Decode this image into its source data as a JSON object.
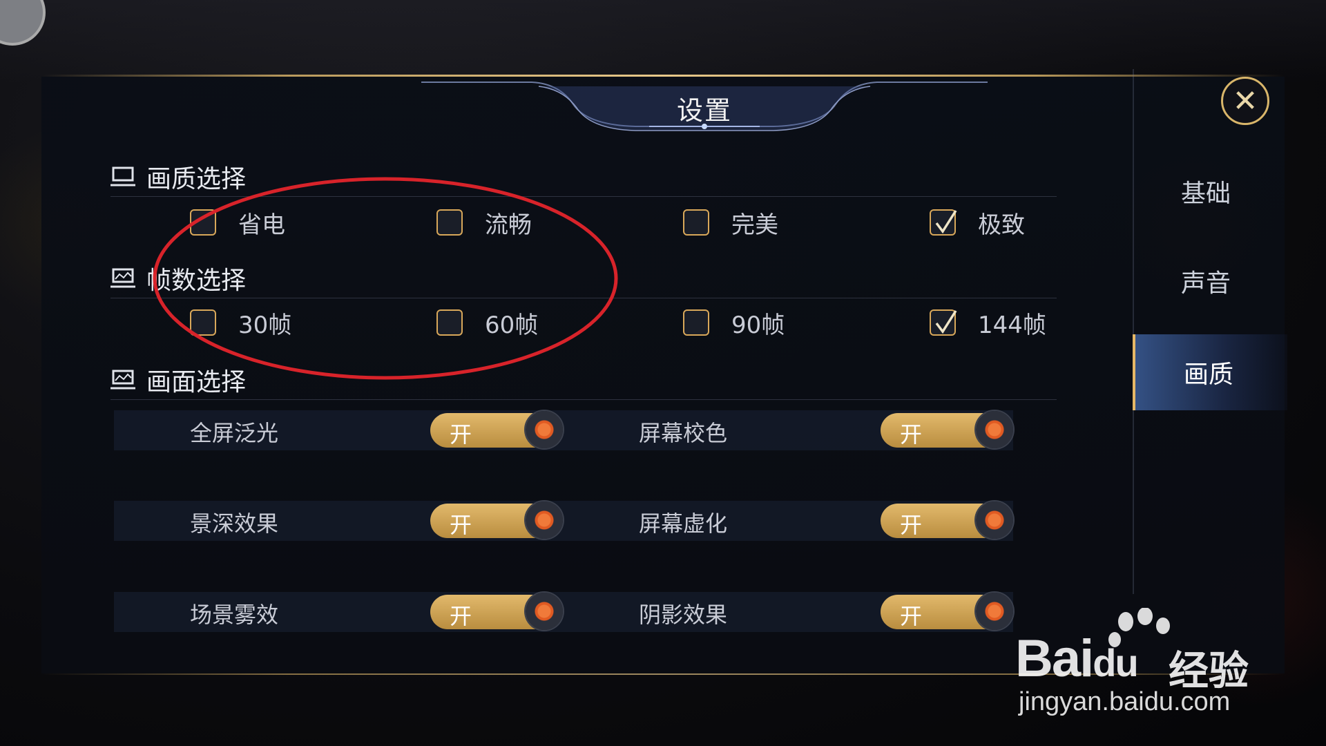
{
  "window": {
    "title": "设置",
    "close_icon": "close-icon"
  },
  "quality": {
    "header": "画质选择",
    "options": [
      {
        "label": "省电",
        "checked": false
      },
      {
        "label": "流畅",
        "checked": false
      },
      {
        "label": "完美",
        "checked": false
      },
      {
        "label": "极致",
        "checked": true
      }
    ]
  },
  "framerate": {
    "header": "帧数选择",
    "options": [
      {
        "label": "30帧",
        "checked": false
      },
      {
        "label": "60帧",
        "checked": false
      },
      {
        "label": "90帧",
        "checked": false
      },
      {
        "label": "144帧",
        "checked": true
      }
    ]
  },
  "screen": {
    "header": "画面选择",
    "toggles": [
      {
        "label": "全屏泛光",
        "state": "开"
      },
      {
        "label": "屏幕校色",
        "state": "开"
      },
      {
        "label": "景深效果",
        "state": "开"
      },
      {
        "label": "屏幕虚化",
        "state": "开"
      },
      {
        "label": "场景雾效",
        "state": "开"
      },
      {
        "label": "阴影效果",
        "state": "开"
      }
    ]
  },
  "sidebar": {
    "tabs": [
      {
        "label": "基础",
        "active": false
      },
      {
        "label": "声音",
        "active": false
      },
      {
        "label": "画质",
        "active": true
      }
    ]
  },
  "watermark": {
    "brand": "Bai",
    "brand_suffix": "du",
    "product": "经验",
    "url": "jingyan.baidu.com"
  },
  "colors": {
    "accent_gold": "#d9a85a",
    "annotation_red": "#d8232a",
    "active_tab": "#4a6eb4"
  }
}
